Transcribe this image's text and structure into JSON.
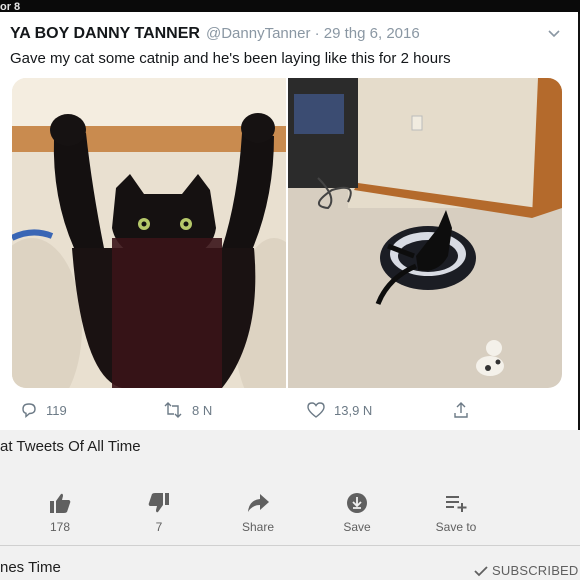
{
  "topbar": {
    "fragment": "or 8"
  },
  "tweet": {
    "author_name": "YA BOY DANNY TANNER",
    "handle_date": "@DannyTanner · 29 thg 6, 2016",
    "text": "Gave my cat some catnip and he's been laying like this for 2 hours",
    "photos": [
      "cat-arms-raised-photo",
      "cat-on-bed-photo"
    ],
    "actions": {
      "replies": "119",
      "retweets": "8 N",
      "likes": "13,9 N"
    },
    "colors": {
      "meta": "#8a97a3",
      "action": "#6c7a86"
    }
  },
  "video": {
    "title_fragment": "at Tweets Of All Time",
    "buttons": {
      "like_count": "178",
      "dislike_count": "7",
      "share_label": "Share",
      "save_label": "Save",
      "save_to_label": "Save to"
    },
    "channel_fragment": "nes Time",
    "subscribe_status": "SUBSCRIBED"
  }
}
